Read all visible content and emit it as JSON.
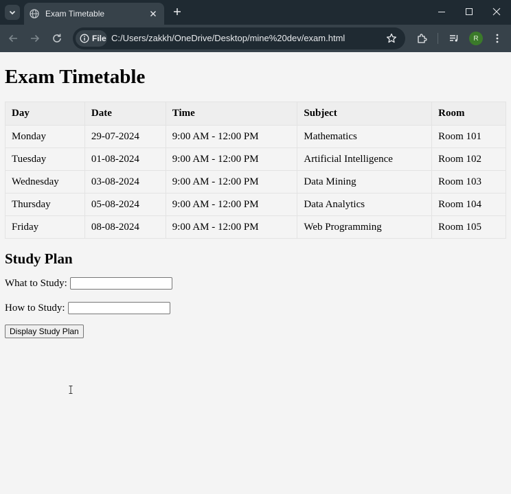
{
  "browser": {
    "tab_title": "Exam Timetable",
    "address_chip": "File",
    "url": "C:/Users/zakkh/OneDrive/Desktop/mine%20dev/exam.html",
    "profile_initial": "R",
    "icons": [
      "chevron-down-icon",
      "globe-icon",
      "close-icon",
      "plus-icon",
      "minimize-icon",
      "maximize-icon",
      "close-window-icon",
      "back-icon",
      "forward-icon",
      "reload-icon",
      "info-icon",
      "star-icon",
      "extensions-icon",
      "media-icon",
      "kebab-menu-icon"
    ]
  },
  "page": {
    "title": "Exam Timetable",
    "table": {
      "headers": [
        "Day",
        "Date",
        "Time",
        "Subject",
        "Room"
      ],
      "rows": [
        [
          "Monday",
          "29-07-2024",
          "9:00 AM - 12:00 PM",
          "Mathematics",
          "Room 101"
        ],
        [
          "Tuesday",
          "01-08-2024",
          "9:00 AM - 12:00 PM",
          "Artificial Intelligence",
          "Room 102"
        ],
        [
          "Wednesday",
          "03-08-2024",
          "9:00 AM - 12:00 PM",
          "Data Mining",
          "Room 103"
        ],
        [
          "Thursday",
          "05-08-2024",
          "9:00 AM - 12:00 PM",
          "Data Analytics",
          "Room 104"
        ],
        [
          "Friday",
          "08-08-2024",
          "9:00 AM - 12:00 PM",
          "Web Programming",
          "Room 105"
        ]
      ]
    },
    "study_plan": {
      "heading": "Study Plan",
      "what_label": "What to Study:",
      "what_value": "",
      "how_label": "How to Study:",
      "how_value": "",
      "button_label": "Display Study Plan"
    }
  },
  "colors": {
    "tabbar": "#1f2a32",
    "toolbar": "#37424a",
    "page_bg": "#f4f4f4",
    "header_bg": "#eeeeee",
    "avatar": "#3b7a2a"
  }
}
